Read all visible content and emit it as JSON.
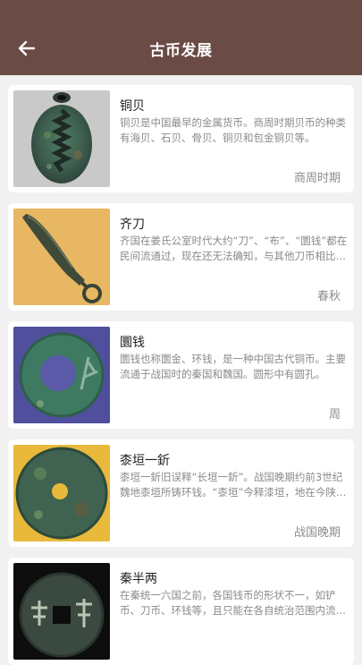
{
  "header": {
    "title": "古币发展",
    "back_icon": "arrow-left-icon",
    "background": "#6a4b45"
  },
  "coins": [
    {
      "name": "铜贝",
      "description": "铜贝是中国最早的金属货币。商周时期贝币的种类有海贝、石贝、骨贝、铜贝和包金铜贝等。",
      "era": "商周时期",
      "image": "copper-shell-coin-image"
    },
    {
      "name": "齐刀",
      "description": "齐国在姜氏公室时代大约“刀”、“布”、“圜钱”都在民间流通过，现在还无法确知，与其他刀币相比较大。",
      "era": "春秋",
      "image": "knife-coin-image"
    },
    {
      "name": "圜钱",
      "description": "圜钱也称圜金、环钱，是一种中国古代铜币。主要流通于战国时的秦国和魏国。圆形中有圆孔。",
      "era": "周",
      "image": "round-coin-image"
    },
    {
      "name": "桼垣一釿",
      "description": "桼垣一釿旧误释“长垣一釿”。战国晚期约前3世纪魏地桼垣所铸环钱。“桼垣”今释漆垣，地在今陕西。",
      "era": "战国晚期",
      "image": "qiyuan-coin-image"
    },
    {
      "name": "秦半两",
      "description": "在秦统一六国之前，各国钱币的形状不一，如铲币、刀币、环钱等，且只能在各自统治范围内流通。",
      "era": "",
      "image": "banliang-coin-image"
    }
  ]
}
